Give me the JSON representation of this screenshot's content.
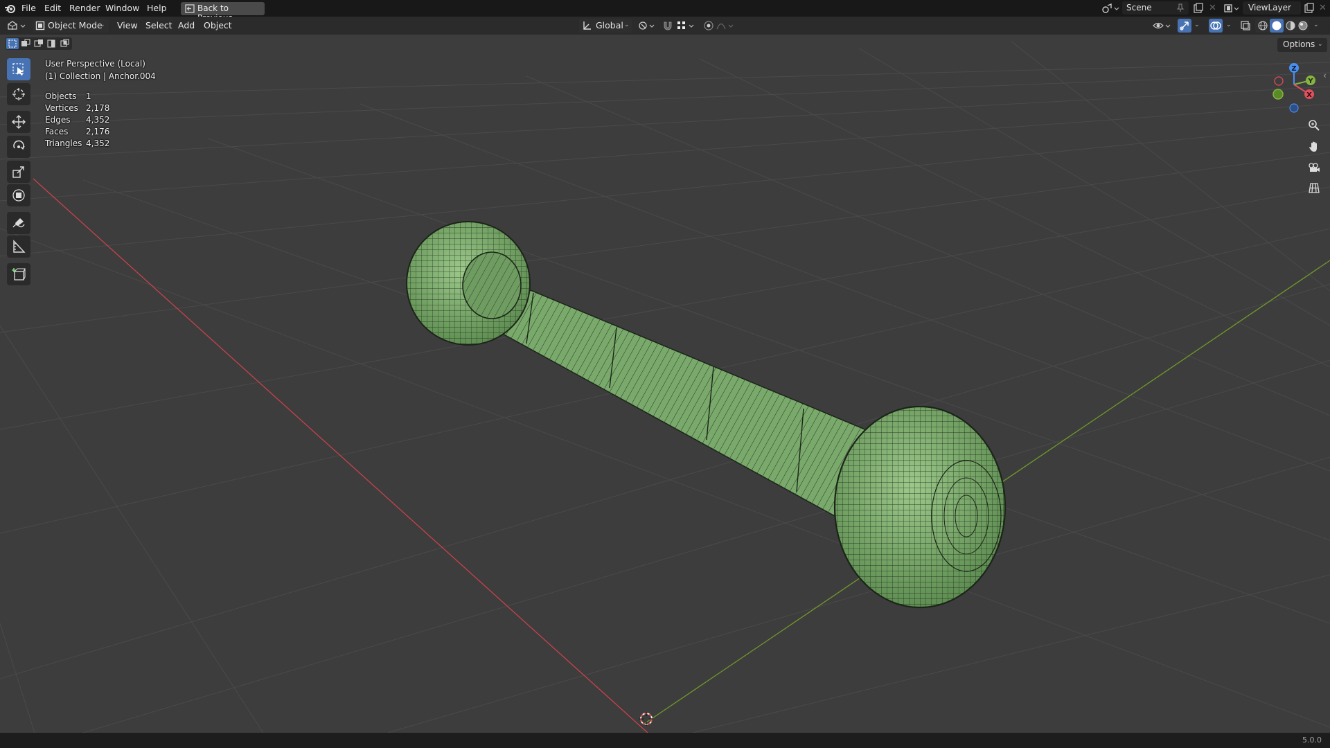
{
  "app": {
    "name": "Blender",
    "version": "5.0.0"
  },
  "menu": [
    "File",
    "Edit",
    "Render",
    "Window",
    "Help"
  ],
  "back_button": "Back to Previous",
  "scene": {
    "label": "Scene",
    "viewlayer": "ViewLayer"
  },
  "header": {
    "mode": "Object Mode",
    "menus": [
      "View",
      "Select",
      "Add",
      "Object"
    ],
    "orientation": "Global",
    "options": "Options"
  },
  "overlay": {
    "perspective": "User Perspective (Local)",
    "collection": "(1) Collection | Anchor.004",
    "stats": [
      {
        "label": "Objects",
        "value": "1"
      },
      {
        "label": "Vertices",
        "value": "2,178"
      },
      {
        "label": "Edges",
        "value": "4,352"
      },
      {
        "label": "Faces",
        "value": "2,176"
      },
      {
        "label": "Triangles",
        "value": "4,352"
      }
    ]
  },
  "gizmo": {
    "axis_z": "Z",
    "axis_y": "Y",
    "axis_x": "X"
  },
  "tools": [
    "select-box-icon",
    "cursor-icon",
    "move-icon",
    "rotate-icon",
    "scale-icon",
    "transform-icon",
    "annotate-icon",
    "measure-icon",
    "add-cube-icon"
  ],
  "colors": {
    "accent": "#4772b3",
    "mesh": "#7fb070",
    "axis_x": "#c8424c",
    "axis_y": "#6f9a2a",
    "grid_bg": "#3d3d3d"
  }
}
